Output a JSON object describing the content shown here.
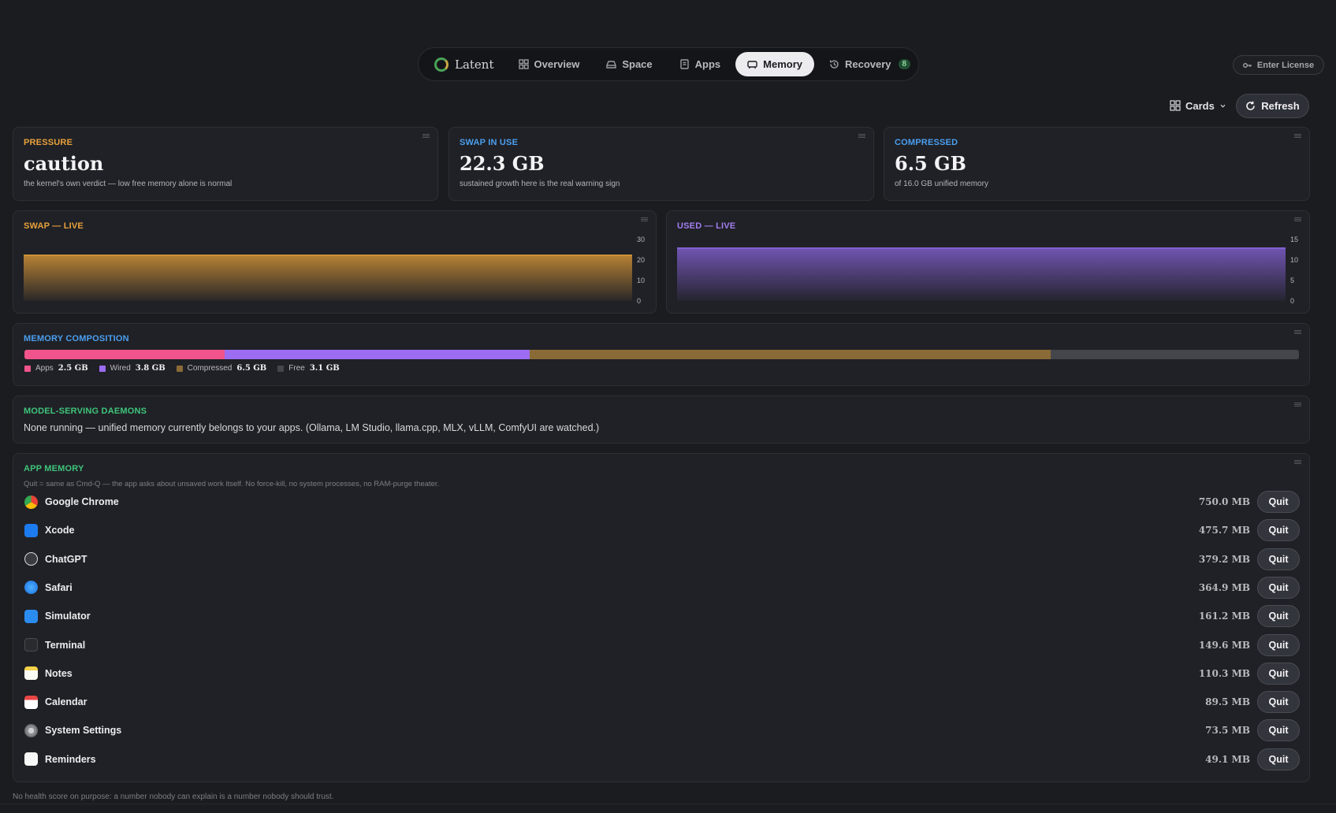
{
  "nav": {
    "brand": "Latent",
    "tabs": [
      {
        "label": "Overview",
        "icon": "grid-icon"
      },
      {
        "label": "Space",
        "icon": "drive-icon"
      },
      {
        "label": "Apps",
        "icon": "apps-icon"
      },
      {
        "label": "Memory",
        "icon": "memory-icon",
        "active": true
      },
      {
        "label": "Recovery",
        "icon": "history-icon",
        "badge": "8"
      }
    ]
  },
  "license": {
    "label": "Enter License"
  },
  "toolbar": {
    "view_label": "Cards",
    "refresh_label": "Refresh"
  },
  "stats": {
    "pressure": {
      "label": "PRESSURE",
      "value": "caution",
      "sub": "the kernel's own verdict — low free memory alone is normal",
      "color": "#e8a13a"
    },
    "swap": {
      "label": "SWAP IN USE",
      "value": "22.3 GB",
      "sub": "sustained growth here is the real warning sign",
      "color": "#4a9ff0"
    },
    "compressed": {
      "label": "COMPRESSED",
      "value": "6.5 GB",
      "sub": "of 16.0 GB unified memory",
      "color": "#4a9ff0"
    }
  },
  "charts": {
    "swap": {
      "label": "SWAP — LIVE",
      "color": "#e8a13a"
    },
    "used": {
      "label": "USED — LIVE",
      "color": "#a27ef0"
    }
  },
  "chart_data": [
    {
      "type": "area",
      "title": "SWAP — LIVE",
      "ylim": [
        0,
        30
      ],
      "yticks": [
        0,
        10,
        20,
        30
      ],
      "series": [
        {
          "values": [
            22.3,
            22.3,
            22.3,
            22.3,
            22.3,
            22.3
          ]
        }
      ],
      "color": "#e8a13a"
    },
    {
      "type": "area",
      "title": "USED — LIVE",
      "ylim": [
        0,
        15
      ],
      "yticks": [
        0,
        5,
        10,
        15
      ],
      "series": [
        {
          "values": [
            12.9,
            12.9,
            12.9,
            12.9,
            12.9,
            12.9
          ]
        }
      ],
      "color": "#8b66e0"
    }
  ],
  "composition": {
    "label": "MEMORY COMPOSITION",
    "segments": [
      {
        "name": "Apps",
        "value": "2.5 GB",
        "gb": 2.5,
        "color": "#f0548a"
      },
      {
        "name": "Wired",
        "value": "3.8 GB",
        "gb": 3.8,
        "color": "#9c6cf2"
      },
      {
        "name": "Compressed",
        "value": "6.5 GB",
        "gb": 6.5,
        "color": "#8a6a36"
      },
      {
        "name": "Free",
        "value": "3.1 GB",
        "gb": 3.1,
        "color": "#45464c"
      }
    ]
  },
  "daemons": {
    "label": "MODEL-SERVING DAEMONS",
    "text": "None running — unified memory currently belongs to your apps. (Ollama, LM Studio, llama.cpp, MLX, vLLM, ComfyUI are watched.)"
  },
  "app_memory": {
    "label": "APP MEMORY",
    "note": "Quit = same as Cmd-Q — the app asks about unsaved work itself. No force-kill, no system processes, no RAM-purge theater.",
    "quit_label": "Quit",
    "apps": [
      {
        "name": "Google Chrome",
        "size": "750.0 MB",
        "icon": "chrome-icon"
      },
      {
        "name": "Xcode",
        "size": "475.7 MB",
        "icon": "xcode-icon"
      },
      {
        "name": "ChatGPT",
        "size": "379.2 MB",
        "icon": "chatgpt-icon"
      },
      {
        "name": "Safari",
        "size": "364.9 MB",
        "icon": "safari-icon"
      },
      {
        "name": "Simulator",
        "size": "161.2 MB",
        "icon": "simulator-icon"
      },
      {
        "name": "Terminal",
        "size": "149.6 MB",
        "icon": "terminal-icon"
      },
      {
        "name": "Notes",
        "size": "110.3 MB",
        "icon": "notes-icon"
      },
      {
        "name": "Calendar",
        "size": "89.5 MB",
        "icon": "calendar-icon"
      },
      {
        "name": "System Settings",
        "size": "73.5 MB",
        "icon": "settings-icon"
      },
      {
        "name": "Reminders",
        "size": "49.1 MB",
        "icon": "reminders-icon"
      }
    ]
  },
  "footer": "No health score on purpose: a number nobody can explain is a number nobody should trust."
}
